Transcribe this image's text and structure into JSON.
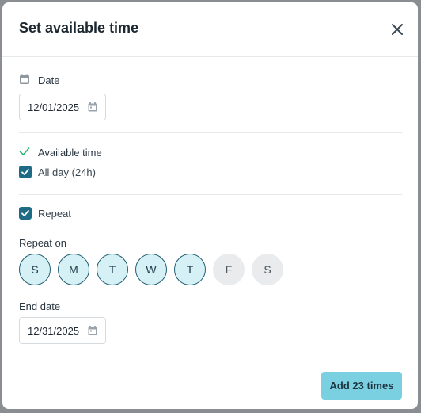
{
  "modal": {
    "title": "Set available time",
    "close_icon": "close-icon"
  },
  "date_section": {
    "label": "Date",
    "icon": "calendar-icon",
    "value": "12/01/2025"
  },
  "available_time": {
    "label": "Available time",
    "icon": "check-icon",
    "all_day_label": "All day (24h)",
    "all_day_checked": true
  },
  "repeat": {
    "label": "Repeat",
    "checked": true,
    "repeat_on_label": "Repeat on",
    "days": [
      {
        "label": "S",
        "selected": true
      },
      {
        "label": "M",
        "selected": true
      },
      {
        "label": "T",
        "selected": true
      },
      {
        "label": "W",
        "selected": true
      },
      {
        "label": "T",
        "selected": true
      },
      {
        "label": "F",
        "selected": false
      },
      {
        "label": "S",
        "selected": false
      }
    ]
  },
  "end_date": {
    "label": "End date",
    "value": "12/31/2025"
  },
  "footer": {
    "add_button_label": "Add 23 times"
  },
  "colors": {
    "accent": "#7acfe0",
    "checkbox": "#1e6b86",
    "check_green": "#2bb673",
    "day_selected_bg": "#d6f1f6",
    "day_unselected_bg": "#e9ebed"
  }
}
